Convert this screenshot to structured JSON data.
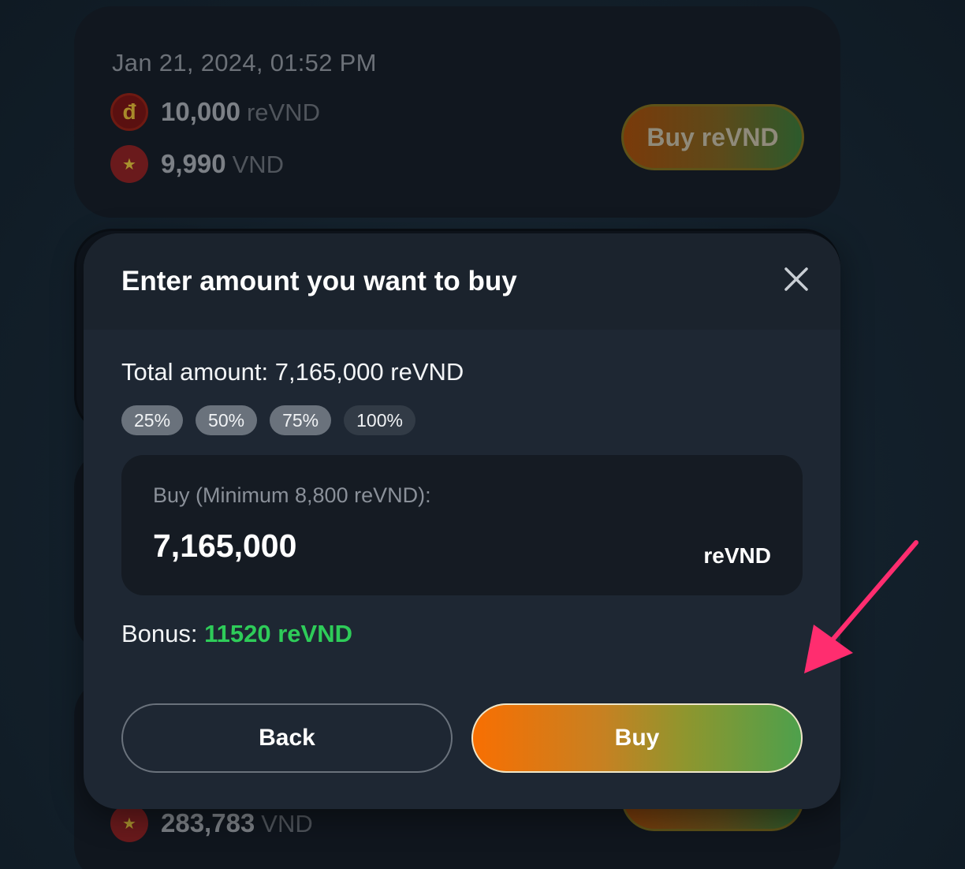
{
  "background_offers": {
    "top": {
      "date": "Jan 21, 2024, 01:52 PM",
      "revnd_amount": "10,000",
      "revnd_unit": "reVND",
      "vnd_amount": "9,990",
      "vnd_unit": "VND",
      "button_label": "Buy reVND"
    },
    "bottom": {
      "vnd_amount": "283,783",
      "vnd_unit": "VND"
    },
    "icons": {
      "revnd_symbol": "đ",
      "vnd_symbol": "★"
    }
  },
  "modal": {
    "title": "Enter amount you want to buy",
    "total_label": "Total amount:",
    "total_value": "7,165,000 reVND",
    "percent_options": [
      "25%",
      "50%",
      "75%",
      "100%"
    ],
    "input": {
      "label": "Buy (Minimum 8,800 reVND):",
      "value": "7,165,000",
      "unit": "reVND"
    },
    "bonus_label": "Bonus:",
    "bonus_value": "11520 reVND",
    "back_label": "Back",
    "buy_label": "Buy"
  },
  "colors": {
    "accent_green": "#2ecc59",
    "buy_gradient_start": "#f86f02",
    "buy_gradient_end": "#4ea04c",
    "annotation_arrow": "#ff2d6f"
  }
}
